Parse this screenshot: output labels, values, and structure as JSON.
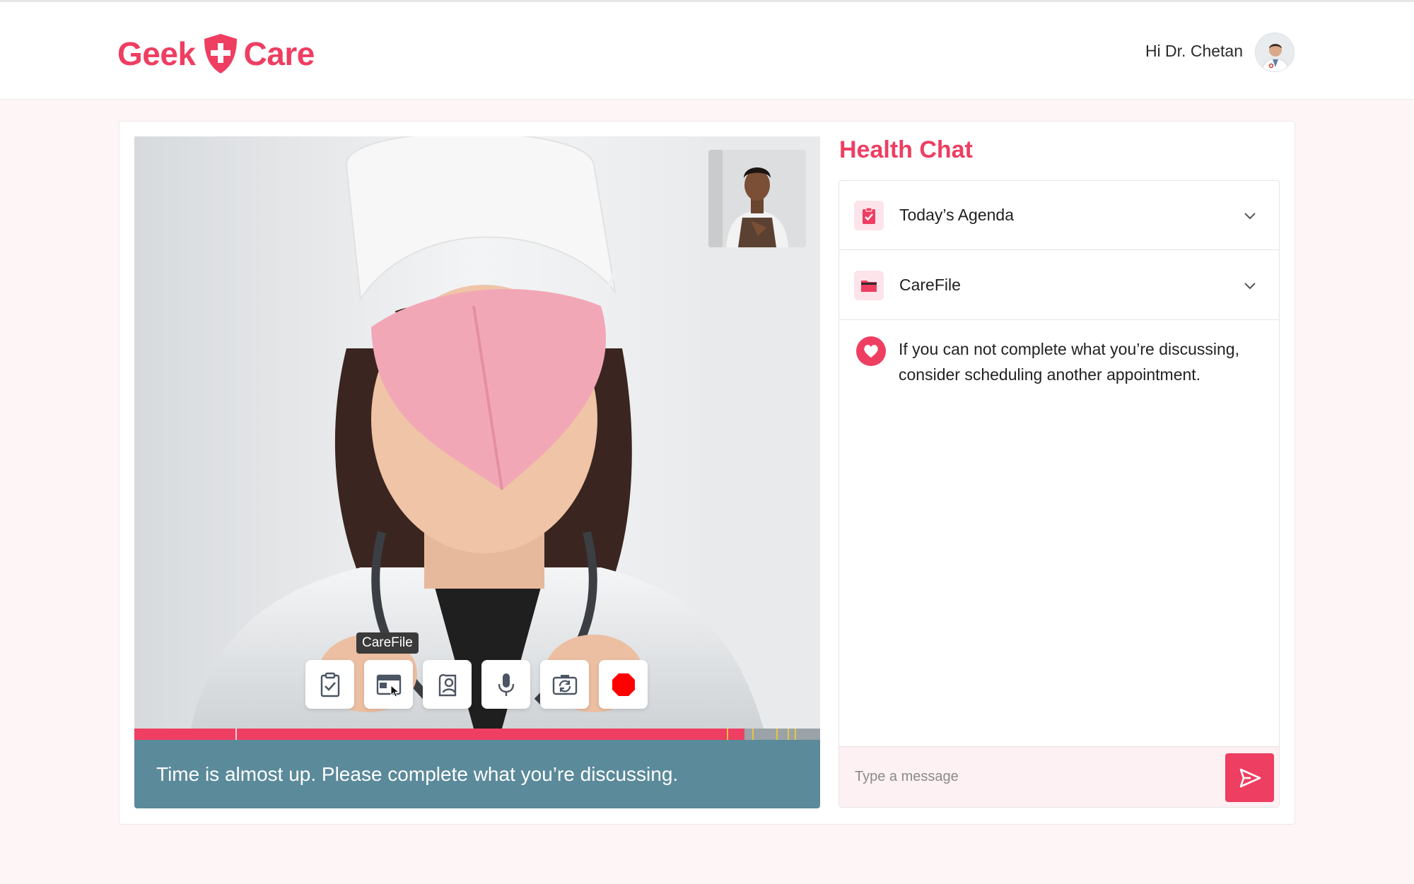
{
  "brand": {
    "name_left": "Geek",
    "name_right": "Care",
    "accent_color": "#ee3e62"
  },
  "header": {
    "greeting": "Hi Dr. Chetan",
    "avatar_icon": "doctor-avatar"
  },
  "video": {
    "tooltip": "CareFile",
    "controls": [
      {
        "name": "agenda-button",
        "icon": "clipboard-check-icon"
      },
      {
        "name": "carefile-button",
        "icon": "carefile-window-icon"
      },
      {
        "name": "screenshare-button",
        "icon": "document-person-icon"
      },
      {
        "name": "microphone-button",
        "icon": "microphone-icon"
      },
      {
        "name": "switch-camera-button",
        "icon": "camera-switch-icon"
      },
      {
        "name": "end-call-button",
        "icon": "record-stop-icon"
      }
    ],
    "time_progress": 0.89,
    "time_warning": "Time is almost up. Please complete what you’re discussing."
  },
  "chat": {
    "title": "Health Chat",
    "sections": [
      {
        "label": "Today’s Agenda",
        "icon": "clipboard-check-icon"
      },
      {
        "label": "CareFile",
        "icon": "folder-icon"
      }
    ],
    "notice": "If you can not complete what you’re discussing, consider scheduling another appointment.",
    "input_placeholder": "Type a message"
  }
}
